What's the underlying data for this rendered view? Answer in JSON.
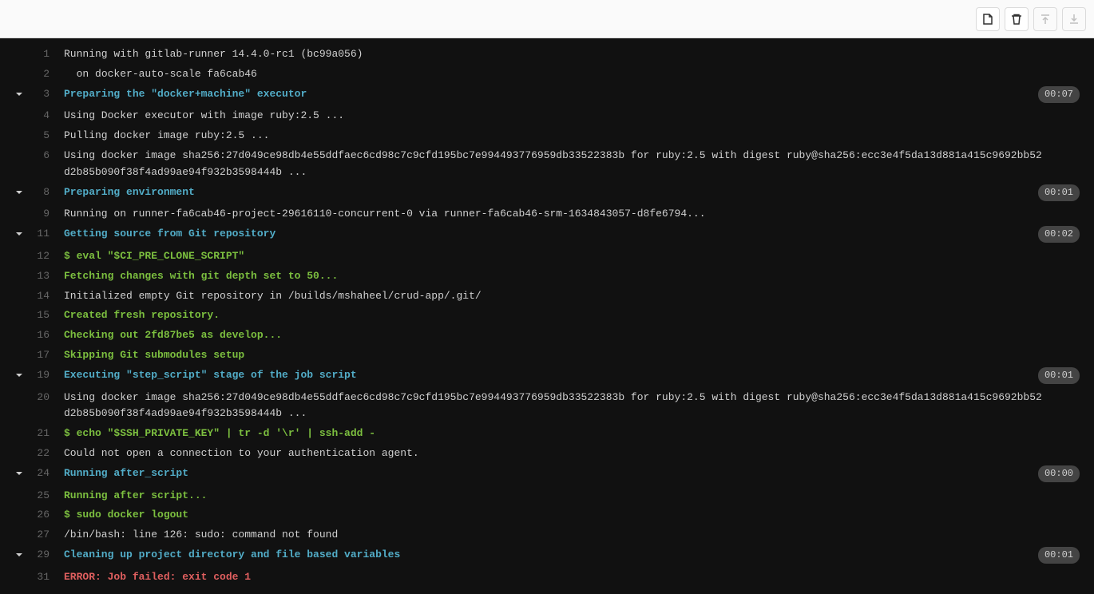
{
  "toolbar": {
    "buttons": [
      {
        "name": "show-complete-raw-button",
        "icon": "file-icon",
        "disabled": false
      },
      {
        "name": "erase-job-log-button",
        "icon": "trash-icon",
        "disabled": false
      },
      {
        "name": "scroll-top-button",
        "icon": "scroll-up-icon",
        "disabled": true
      },
      {
        "name": "scroll-bottom-button",
        "icon": "scroll-down-icon",
        "disabled": true
      }
    ]
  },
  "lines": [
    {
      "num": "1",
      "chevron": false,
      "cls": "c-white",
      "text": "Running with gitlab-runner 14.4.0-rc1 (bc99a056)",
      "duration": null
    },
    {
      "num": "2",
      "chevron": false,
      "cls": "c-white",
      "text": "  on docker-auto-scale fa6cab46",
      "duration": null
    },
    {
      "num": "3",
      "chevron": true,
      "cls": "c-cyan",
      "text": "Preparing the \"docker+machine\" executor",
      "duration": "00:07"
    },
    {
      "num": "4",
      "chevron": false,
      "cls": "c-white",
      "text": "Using Docker executor with image ruby:2.5 ...",
      "duration": null
    },
    {
      "num": "5",
      "chevron": false,
      "cls": "c-white",
      "text": "Pulling docker image ruby:2.5 ...",
      "duration": null
    },
    {
      "num": "6",
      "chevron": false,
      "cls": "c-white",
      "text": "Using docker image sha256:27d049ce98db4e55ddfaec6cd98c7c9cfd195bc7e994493776959db33522383b for ruby:2.5 with digest ruby@sha256:ecc3e4f5da13d881a415c9692bb52d2b85b090f38f4ad99ae94f932b3598444b ...",
      "duration": null
    },
    {
      "num": "8",
      "chevron": true,
      "cls": "c-cyan",
      "text": "Preparing environment",
      "duration": "00:01"
    },
    {
      "num": "9",
      "chevron": false,
      "cls": "c-white",
      "text": "Running on runner-fa6cab46-project-29616110-concurrent-0 via runner-fa6cab46-srm-1634843057-d8fe6794...",
      "duration": null
    },
    {
      "num": "11",
      "chevron": true,
      "cls": "c-cyan",
      "text": "Getting source from Git repository",
      "duration": "00:02"
    },
    {
      "num": "12",
      "chevron": false,
      "cls": "c-green",
      "text": "$ eval \"$CI_PRE_CLONE_SCRIPT\"",
      "duration": null
    },
    {
      "num": "13",
      "chevron": false,
      "cls": "c-green",
      "text": "Fetching changes with git depth set to 50...",
      "duration": null
    },
    {
      "num": "14",
      "chevron": false,
      "cls": "c-white",
      "text": "Initialized empty Git repository in /builds/mshaheel/crud-app/.git/",
      "duration": null
    },
    {
      "num": "15",
      "chevron": false,
      "cls": "c-green",
      "text": "Created fresh repository.",
      "duration": null
    },
    {
      "num": "16",
      "chevron": false,
      "cls": "c-green",
      "text": "Checking out 2fd87be5 as develop...",
      "duration": null
    },
    {
      "num": "17",
      "chevron": false,
      "cls": "c-green",
      "text": "Skipping Git submodules setup",
      "duration": null
    },
    {
      "num": "19",
      "chevron": true,
      "cls": "c-cyan",
      "text": "Executing \"step_script\" stage of the job script",
      "duration": "00:01"
    },
    {
      "num": "20",
      "chevron": false,
      "cls": "c-white",
      "text": "Using docker image sha256:27d049ce98db4e55ddfaec6cd98c7c9cfd195bc7e994493776959db33522383b for ruby:2.5 with digest ruby@sha256:ecc3e4f5da13d881a415c9692bb52d2b85b090f38f4ad99ae94f932b3598444b ...",
      "duration": null
    },
    {
      "num": "21",
      "chevron": false,
      "cls": "c-green",
      "text": "$ echo \"$SSH_PRIVATE_KEY\" | tr -d '\\r' | ssh-add -",
      "duration": null
    },
    {
      "num": "22",
      "chevron": false,
      "cls": "c-white",
      "text": "Could not open a connection to your authentication agent.",
      "duration": null
    },
    {
      "num": "24",
      "chevron": true,
      "cls": "c-cyan",
      "text": "Running after_script",
      "duration": "00:00"
    },
    {
      "num": "25",
      "chevron": false,
      "cls": "c-green",
      "text": "Running after script...",
      "duration": null
    },
    {
      "num": "26",
      "chevron": false,
      "cls": "c-green",
      "text": "$ sudo docker logout",
      "duration": null
    },
    {
      "num": "27",
      "chevron": false,
      "cls": "c-white",
      "text": "/bin/bash: line 126: sudo: command not found",
      "duration": null
    },
    {
      "num": "29",
      "chevron": true,
      "cls": "c-cyan",
      "text": "Cleaning up project directory and file based variables",
      "duration": "00:01"
    },
    {
      "num": "31",
      "chevron": false,
      "cls": "c-red",
      "text": "ERROR: Job failed: exit code 1",
      "duration": null
    }
  ]
}
